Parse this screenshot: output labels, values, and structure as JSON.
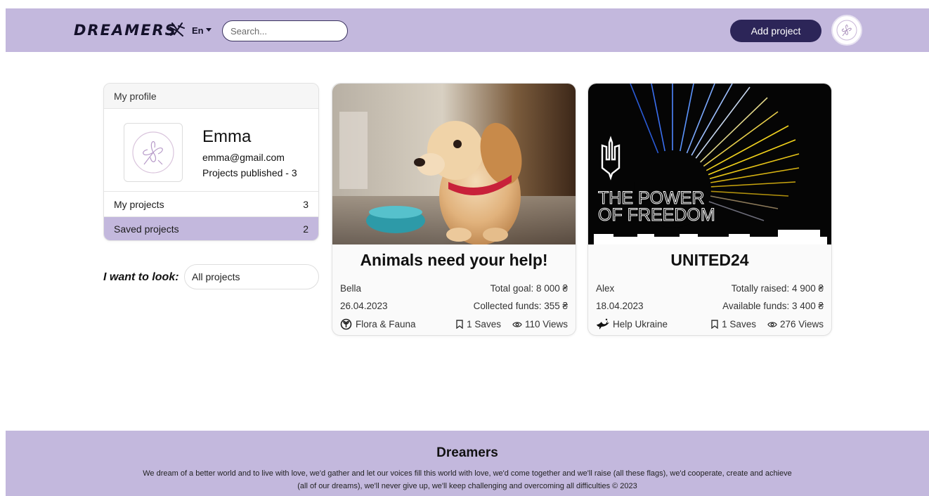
{
  "header": {
    "logo": "DREAMERS",
    "lang": "En",
    "search_placeholder": "Search...",
    "add_button": "Add project"
  },
  "profile": {
    "header": "My profile",
    "name": "Emma",
    "email": "emma@gmail.com",
    "projects_published": "Projects published - 3",
    "menu": [
      {
        "label": "My projects",
        "count": "3",
        "active": false
      },
      {
        "label": "Saved projects",
        "count": "2",
        "active": true
      }
    ]
  },
  "filter": {
    "label": "I want to look:",
    "value": "All projects"
  },
  "cards": [
    {
      "title": "Animals need your help!",
      "author": "Bella",
      "date": "26.04.2023",
      "money_1": "Total goal: 8 000 ₴",
      "money_2": "Collected funds: 355 ₴",
      "category": "Flora & Fauna",
      "category_icon": "plant-icon",
      "saves": "1 Saves",
      "views": "110 Views"
    },
    {
      "title": "UNITED24",
      "image_text_1": "THE POWER",
      "image_text_2": "OF FREEDOM",
      "author": "Alex",
      "date": "18.04.2023",
      "money_1": "Totally raised: 4 900 ₴",
      "money_2": "Available funds: 3 400 ₴",
      "category": "Help Ukraine",
      "category_icon": "dove-icon",
      "saves": "1 Saves",
      "views": "276 Views"
    }
  ],
  "footer": {
    "title": "Dreamers",
    "text": "We dream of a better world and to live with love, we'd gather and let our voices fill this world with love, we'd come together and we'll raise (all these flags), we'd cooperate, create and achieve (all of our dreams), we'll never give up, we'll keep challenging and overcoming all difficulties © 2023"
  },
  "colors": {
    "accent": "#c3b8dd",
    "button": "#2c2558"
  }
}
